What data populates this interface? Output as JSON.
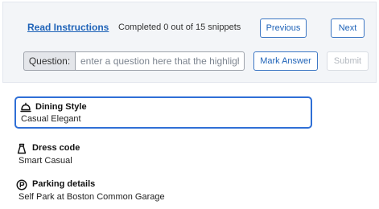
{
  "header": {
    "instructions_link": "Read Instructions",
    "progress_text": "Completed 0 out of 15 snippets",
    "previous_label": "Previous",
    "next_label": "Next"
  },
  "question": {
    "label": "Question:",
    "placeholder": "enter a question here that the highlighted text answers",
    "value": "",
    "mark_answer_label": "Mark Answer",
    "submit_label": "Submit"
  },
  "details": [
    {
      "icon": "bell-icon",
      "title": "Dining Style",
      "value": "Casual Elegant",
      "selected": true
    },
    {
      "icon": "dress-icon",
      "title": "Dress code",
      "value": "Smart Casual",
      "selected": false
    },
    {
      "icon": "parking-icon",
      "title": "Parking details",
      "value": "Self Park at Boston Common Garage",
      "selected": false
    }
  ],
  "colors": {
    "accent": "#1f63b8",
    "highlight_border": "#2f6fd6",
    "panel_bg": "#f3f5f8"
  }
}
